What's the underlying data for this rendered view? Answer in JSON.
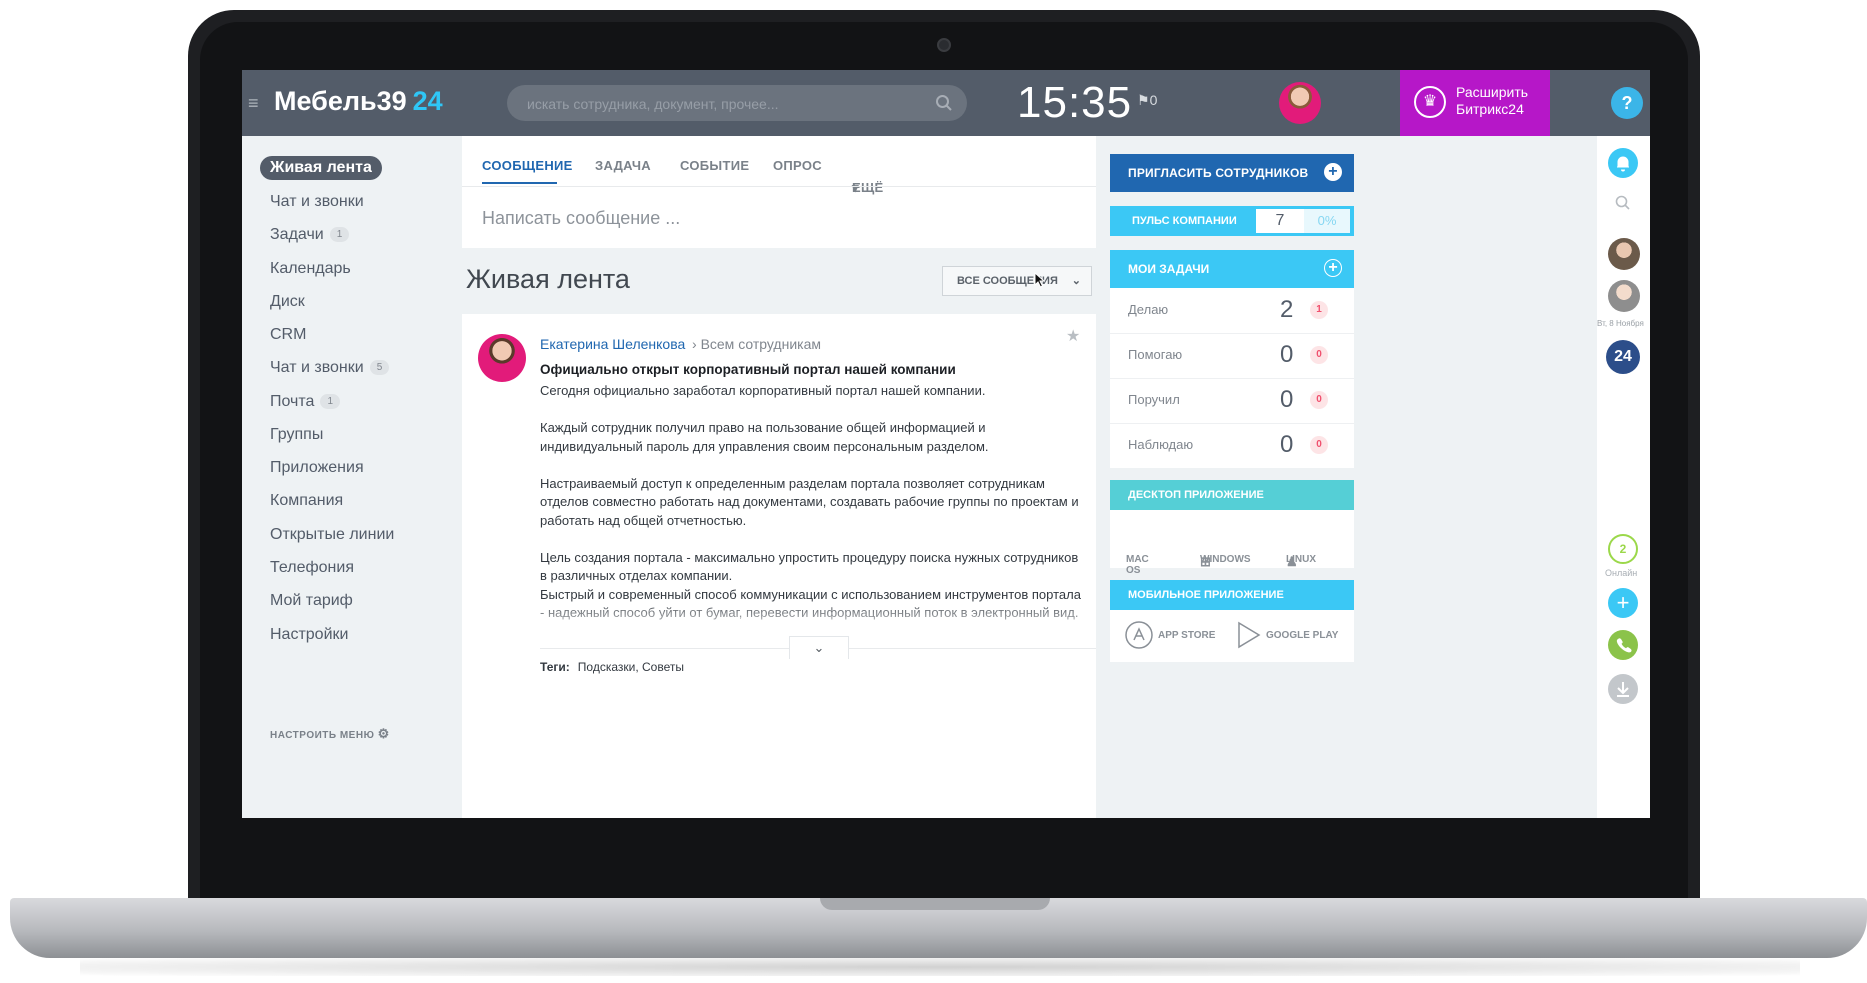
{
  "header": {
    "logo_name": "Мебель39",
    "logo_num": "24",
    "search_placeholder": "искать сотрудника, документ, прочее...",
    "clock": "15:35",
    "flag": "0",
    "extend_label_1": "Расширить",
    "extend_label_2": "Битрикс24",
    "help": "?"
  },
  "sidebar": {
    "items": [
      {
        "label": "Живая лента"
      },
      {
        "label": "Чат и звонки"
      },
      {
        "label": "Задачи",
        "badge": "1"
      },
      {
        "label": "Календарь"
      },
      {
        "label": "Диск"
      },
      {
        "label": "CRM"
      },
      {
        "label": "Чат и звонки",
        "badge": "5"
      },
      {
        "label": "Почта",
        "badge": "1"
      },
      {
        "label": "Группы"
      },
      {
        "label": "Приложения"
      },
      {
        "label": "Компания"
      },
      {
        "label": "Открытые линии"
      },
      {
        "label": "Телефония"
      },
      {
        "label": "Мой тариф"
      },
      {
        "label": "Настройки"
      }
    ],
    "configure": "НАСТРОИТЬ МЕНЮ"
  },
  "composer": {
    "tabs": [
      "СООБЩЕНИЕ",
      "ЗАДАЧА",
      "СОБЫТИЕ",
      "ОПРОС",
      "ЕЩЁ"
    ],
    "placeholder": "Написать сообщение ..."
  },
  "feed": {
    "title": "Живая лента",
    "filter": "ВСЕ СООБЩЕНИЯ",
    "post": {
      "author": "Екатерина Шеленкова",
      "recipient": "Всем сотрудникам",
      "title": "Официально открыт корпоративный портал нашей компании",
      "body": "Сегодня официально заработал корпоративный портал нашей компании.\n\nКаждый сотрудник получил право на пользование общей информацией и индивидуальный пароль для управления своим персональным разделом.\n\nНастраиваемый доступ к определенным разделам портала позволяет сотрудникам отделов совместно работать над документами, создавать рабочие группы по проектам и работать над общей отчетностью.\n\nЦель создания портала - максимально упростить процедуру поиска нужных сотрудников в различных отделах компании.\nБыстрый и современный способ коммуникации с использованием инструментов портала - надежный способ уйти от бумаг, перевести информационный поток в электронный вид.",
      "tags_label": "Теги:",
      "tags": "Подсказки, Советы"
    }
  },
  "right": {
    "invite": "ПРИГЛАСИТЬ СОТРУДНИКОВ",
    "pulse_label": "ПУЛЬС КОМПАНИИ",
    "pulse_value": "7",
    "pulse_pct": "0%",
    "tasks_title": "МОИ ЗАДАЧИ",
    "tasks": [
      {
        "label": "Делаю",
        "count": "2",
        "badge": "1"
      },
      {
        "label": "Помогаю",
        "count": "0",
        "badge": "0"
      },
      {
        "label": "Поручил",
        "count": "0",
        "badge": "0"
      },
      {
        "label": "Наблюдаю",
        "count": "0",
        "badge": "0"
      }
    ],
    "desktop_title": "ДЕСКТОП ПРИЛОЖЕНИЕ",
    "desktop": [
      "MAC OS",
      "WINDOWS",
      "LINUX"
    ],
    "mobile_title": "МОБИЛЬНОЕ ПРИЛОЖЕНИЕ",
    "mobile": [
      "APP STORE",
      "GOOGLE PLAY"
    ]
  },
  "rail": {
    "date": "Вт, 8 Ноября",
    "b24": "24",
    "online_count": "2",
    "online_label": "Онлайн"
  },
  "colors": {
    "header": "#535c69",
    "accent_blue": "#2067b0",
    "light_blue": "#3bc8f5",
    "extend_purple": "#b617c8"
  }
}
